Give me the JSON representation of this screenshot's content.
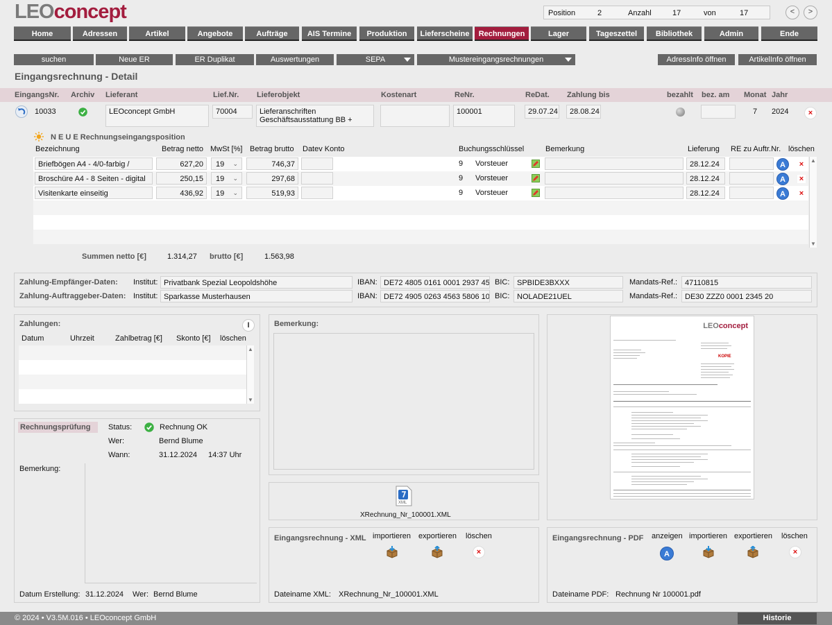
{
  "app": {
    "logo_part1": "LEO",
    "logo_part2": "concept"
  },
  "position_box": {
    "position_label": "Position",
    "position_value": "2",
    "anzahl_label": "Anzahl",
    "anzahl_value": "17",
    "von_label": "von",
    "von_value": "17"
  },
  "nav_arrows": {
    "prev": "<",
    "next": ">"
  },
  "nav": [
    "Home",
    "Adressen",
    "Artikel",
    "Angebote",
    "Aufträge",
    "AIS Termine",
    "Produktion",
    "Lieferscheine",
    "Rechnungen",
    "Lager",
    "Tageszettel",
    "Bibliothek",
    "Admin",
    "Ende"
  ],
  "nav_active": "Rechnungen",
  "toolbar": {
    "suchen": "suchen",
    "neue_er": "Neue ER",
    "er_duplikat": "ER Duplikat",
    "auswertungen": "Auswertungen",
    "sepa": "SEPA",
    "mustereingangsrechnungen": "Mustereingangsrechnungen",
    "adressinfo": "AdressInfo öffnen",
    "artikelinfo": "ArtikelInfo öffnen"
  },
  "page_title": "Eingangsrechnung - Detail",
  "header_cols": {
    "eingangsnr": "EingangsNr.",
    "archiv": "Archiv",
    "lieferant": "Lieferant",
    "liefnr": "Lief.Nr.",
    "lieferobjekt": "Lieferobjekt",
    "kostenart": "Kostenart",
    "renr": "ReNr.",
    "redat": "ReDat.",
    "zahlung_bis": "Zahlung bis",
    "bezahlt": "bezahlt",
    "bez_am": "bez. am",
    "monat": "Monat",
    "jahr": "Jahr"
  },
  "record": {
    "eingangsnr": "10033",
    "lieferant": "LEOconcept GmbH",
    "liefnr": "70004",
    "lieferobjekt_line1": "Lieferanschriften",
    "lieferobjekt_line2": "Geschäftsausstattung BB +",
    "kostenart": "",
    "renr": "100001",
    "redat": "29.07.24",
    "zahlung_bis": "28.08.24",
    "bez_am": "",
    "monat": "7",
    "jahr": "2024"
  },
  "positions": {
    "new_label": "N E U E",
    "new_suffix": "Rechnungseingangsposition",
    "cols": {
      "bezeichnung": "Bezeichnung",
      "betrag_netto": "Betrag netto",
      "mwst": "MwSt [%]",
      "betrag_brutto": "Betrag brutto",
      "datev": "Datev Konto",
      "buchungsschluessel": "Buchungsschlüssel",
      "bemerkung": "Bemerkung",
      "lieferung": "Lieferung",
      "re_zu_auftr": "RE zu Auftr.Nr.",
      "loeschen": "löschen"
    },
    "rows": [
      {
        "bezeichnung": "Briefbögen A4 - 4/0-farbig /",
        "netto": "627,20",
        "mwst": "19",
        "brutto": "746,37",
        "datev": "",
        "bs_nr": "9",
        "bs_text": "Vorsteuer",
        "bemerkung": "",
        "lieferung": "28.12.24",
        "re_auftr": "",
        "a_label": "A",
        "x_label": "×"
      },
      {
        "bezeichnung": "Broschüre A4 - 8 Seiten - digital",
        "netto": "250,15",
        "mwst": "19",
        "brutto": "297,68",
        "datev": "",
        "bs_nr": "9",
        "bs_text": "Vorsteuer",
        "bemerkung": "",
        "lieferung": "28.12.24",
        "re_auftr": "",
        "a_label": "A",
        "x_label": "×"
      },
      {
        "bezeichnung": "Visitenkarte einseitig",
        "netto": "436,92",
        "mwst": "19",
        "brutto": "519,93",
        "datev": "",
        "bs_nr": "9",
        "bs_text": "Vorsteuer",
        "bemerkung": "",
        "lieferung": "28.12.24",
        "re_auftr": "",
        "a_label": "A",
        "x_label": "×"
      }
    ],
    "summen_netto_label": "Summen netto [€]",
    "summen_netto": "1.314,27",
    "brutto_label": "brutto [€]",
    "brutto": "1.563,98"
  },
  "bank": {
    "empfaenger_label": "Zahlung-Empfänger-Daten:",
    "auftraggeber_label": "Zahlung-Auftraggeber-Daten:",
    "institut_label": "Institut:",
    "iban_label": "IBAN:",
    "bic_label": "BIC:",
    "mandats_label": "Mandats-Ref.:",
    "empfaenger": {
      "institut": "Privatbank Spezial Leopoldshöhe",
      "iban": "DE72 4805 0161 0001 2937 45",
      "bic": "SPBIDE3BXXX",
      "mandats": "47110815"
    },
    "auftraggeber": {
      "institut": "Sparkasse Musterhausen",
      "iban": "DE72 4905 0263 4563 5806 10",
      "bic": "NOLADE21UEL",
      "mandats": "DE30 ZZZ0 0001 2345 20"
    }
  },
  "zahlungen": {
    "title": "Zahlungen:",
    "cols": {
      "datum": "Datum",
      "uhrzeit": "Uhrzeit",
      "zahlbetrag": "Zahlbetrag [€]",
      "skonto": "Skonto [€]",
      "loeschen": "löschen"
    },
    "info_icon": "I"
  },
  "bemerkung_title": "Bemerkung:",
  "pruefung": {
    "title": "Rechnungsprüfung",
    "status_label": "Status:",
    "status_value": "Rechnung OK",
    "wer_label": "Wer:",
    "wer_value": "Bernd Blume",
    "wann_label": "Wann:",
    "wann_date": "31.12.2024",
    "wann_time": "14:37 Uhr",
    "bemerkung_label": "Bemerkung:",
    "erstellung_label": "Datum Erstellung:",
    "erstellung_date": "31.12.2024",
    "erstellung_wer_label": "Wer:",
    "erstellung_wer": "Bernd Blume"
  },
  "xml_file": {
    "name": "XRechnung_Nr_100001.XML",
    "icon_label": "XML"
  },
  "xml_panel": {
    "title": "Eingangsrechnung - XML",
    "importieren": "importieren",
    "exportieren": "exportieren",
    "loeschen": "löschen",
    "dateiname_label": "Dateiname XML:",
    "dateiname": "XRechnung_Nr_100001.XML"
  },
  "pdf_panel": {
    "title": "Eingangsrechnung - PDF",
    "anzeigen": "anzeigen",
    "importieren": "importieren",
    "exportieren": "exportieren",
    "loeschen": "löschen",
    "dateiname_label": "Dateiname PDF:",
    "dateiname": "Rechnung Nr 100001.pdf"
  },
  "preview": {
    "logo_part1": "LEO",
    "logo_part2": "concept",
    "kopie": "KOPIE"
  },
  "footer": {
    "text": "© 2024 • V3.5M.016 • LEOconcept GmbH",
    "historie": "Historie"
  },
  "colors": {
    "accent": "#a31d3e",
    "nav_bg": "#666666",
    "header_band": "#e4d3d8",
    "ok_green": "#3cb043",
    "delete_red": "#dd1111",
    "a_blue": "#3a7bd5"
  }
}
